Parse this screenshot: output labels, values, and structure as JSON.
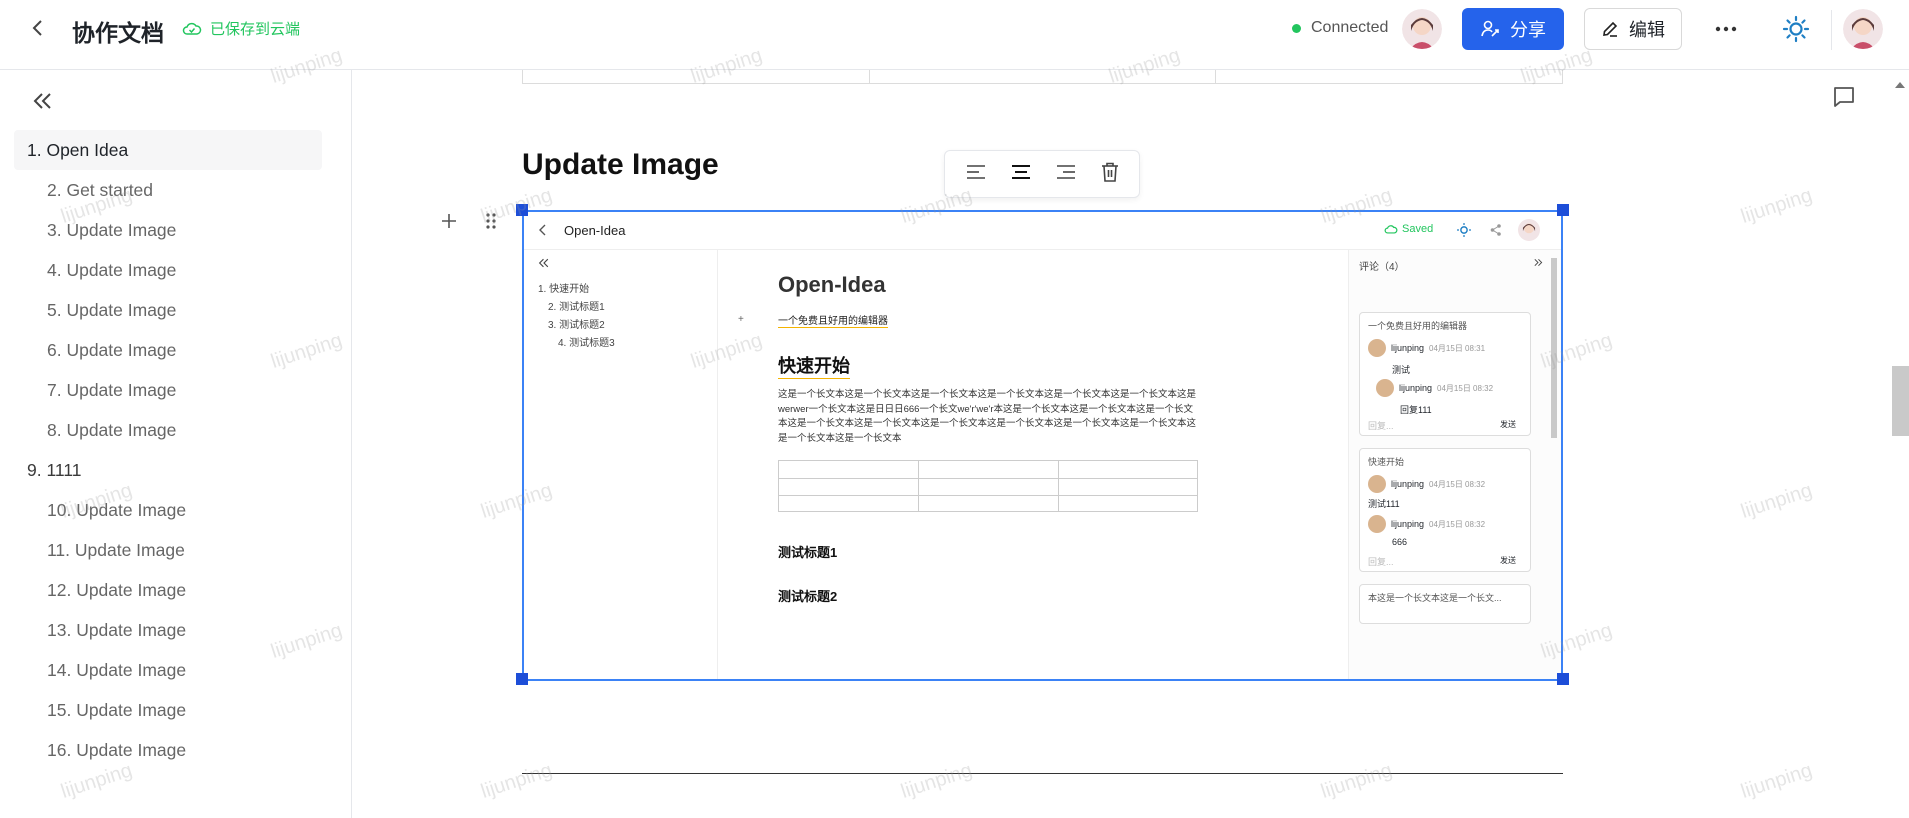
{
  "header": {
    "title": "协作文档",
    "save_status": "已保存到云端",
    "connection": "Connected",
    "share_label": "分享",
    "edit_label": "编辑"
  },
  "toc": [
    {
      "label": "1. Open Idea",
      "level": 1,
      "active": true
    },
    {
      "label": "2. Get started",
      "level": 2
    },
    {
      "label": "3. Update Image",
      "level": 2
    },
    {
      "label": "4. Update Image",
      "level": 2
    },
    {
      "label": "5. Update Image",
      "level": 2
    },
    {
      "label": "6. Update Image",
      "level": 2
    },
    {
      "label": "7. Update Image",
      "level": 2
    },
    {
      "label": "8. Update Image",
      "level": 2
    },
    {
      "label": "9. 1111",
      "level": 1
    },
    {
      "label": "10. Update Image",
      "level": 2
    },
    {
      "label": "11. Update Image",
      "level": 2
    },
    {
      "label": "12. Update Image",
      "level": 2
    },
    {
      "label": "13. Update Image",
      "level": 2
    },
    {
      "label": "14. Update Image",
      "level": 2
    },
    {
      "label": "15. Update Image",
      "level": 2
    },
    {
      "label": "16. Update Image",
      "level": 2
    }
  ],
  "content": {
    "heading": "Update Image"
  },
  "embedded": {
    "title": "Open-Idea",
    "saved": "Saved",
    "toc": [
      "1. 快速开始",
      "2. 测试标题1",
      "3. 测试标题2",
      "4. 测试标题3"
    ],
    "doc_title": "Open-Idea",
    "subtitle": "一个免费且好用的编辑器",
    "h_quick": "快速开始",
    "para": "这是一个长文本这是一个长文本这是一个长文本这是一个长文本这是一个长文本这是一个长文本这是werwer一个长文本这是日日日666一个长文we'r'we'r本这是一个长文本这是一个长文本这是一个长文本这是一个长文本这是一个长文本这是一个长文本这是一个长文本这是一个长文本这是一个长文本这是一个长文本这是一个长文本",
    "h_t1": "测试标题1",
    "h_t2": "测试标题2",
    "comments_title": "评论（4）",
    "card1": {
      "quote": "一个免费且好用的编辑器",
      "c1_user": "lijunping",
      "c1_time": "04月15日 08:31",
      "c1_text": "测试",
      "c2_user": "lijunping",
      "c2_time": "04月15日 08:32",
      "c2_text": "回复111",
      "reply_ph": "回复...",
      "send": "发送"
    },
    "card2": {
      "quote": "快速开始",
      "c1_user": "lijunping",
      "c1_time": "04月15日 08:32",
      "c1_text": "测试111",
      "c2_user": "lijunping",
      "c2_time": "04月15日 08:32",
      "c2_text": "666",
      "reply_ph": "回复...",
      "send": "发送"
    },
    "card3_quote": "本这是一个长文本这是一个长文..."
  },
  "watermark": "lijunping",
  "colors": {
    "accent": "#2563eb",
    "success": "#22c55e",
    "selection": "#3b82f6"
  }
}
